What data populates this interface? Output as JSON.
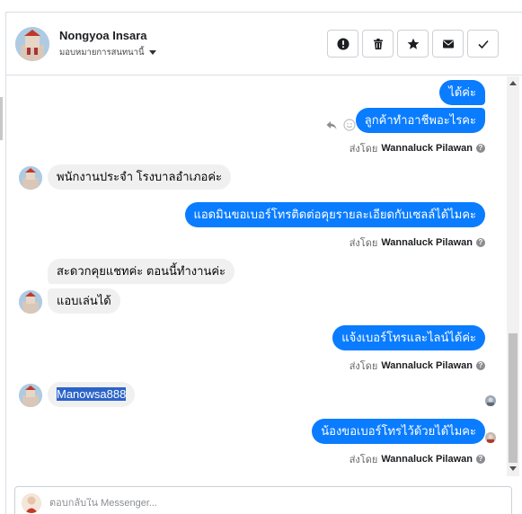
{
  "contact": {
    "name": "Nongyoa Insara",
    "assign_label": "มอบหมายการสนทนานี้"
  },
  "actions": [
    {
      "icon": "alert-icon",
      "name": "mark-spam-button"
    },
    {
      "icon": "trash-icon",
      "name": "delete-button"
    },
    {
      "icon": "star-icon",
      "name": "star-button"
    },
    {
      "icon": "envelope-icon",
      "name": "mark-unread-button"
    },
    {
      "icon": "check-icon",
      "name": "mark-done-button"
    }
  ],
  "messages": {
    "m1": "ได้ค่ะ",
    "m2": "ลูกค้าทำอาชีพอะไรคะ",
    "m3": "พนักงานประจำ โรงบาลอำเภอค่ะ",
    "m4": "แอดมินขอเบอร์โทรติดต่อคุยรายละเอียดกับเซลล์ได้ไมคะ",
    "m5": "สะดวกคุยแชทค่ะ ตอนนี้ทำงานค่ะ",
    "m6": "แอบเล่นได้",
    "m7": "แจ้งเบอร์โทรและไลน์ได้ค่ะ",
    "m8": "Manowsa888",
    "m9": "น้องขอเบอร์โทรไว้ด้วยได้ไมคะ"
  },
  "sent_by": {
    "prefix": "ส่งโดย",
    "name": "Wannaluck Pilawan",
    "info": "?"
  },
  "composer": {
    "placeholder": "ตอบกลับใน Messenger..."
  },
  "colors": {
    "outgoing_bubble": "#0a7cff",
    "incoming_bubble": "#f0f0f0",
    "highlight": "#2b63c9"
  }
}
